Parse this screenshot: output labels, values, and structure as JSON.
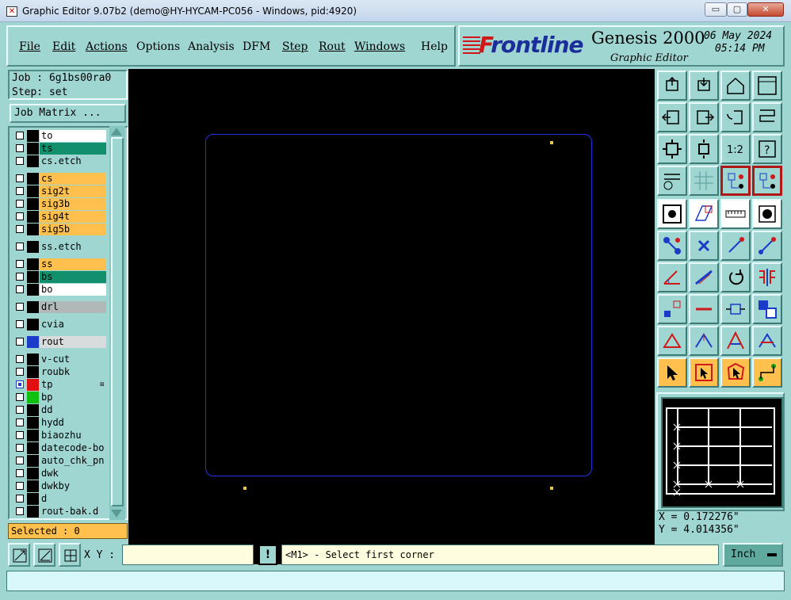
{
  "window": {
    "title": "Graphic Editor 9.07b2 (demo@HY-HYCAM-PC056 - Windows, pid:4920)",
    "min_glyph": "▭",
    "max_glyph": "▢",
    "close_glyph": "✕"
  },
  "menu": {
    "items": [
      "File",
      "Edit",
      "Actions",
      "Options",
      "Analysis",
      "DFM",
      "Step",
      "Rout",
      "Windows",
      "Help"
    ]
  },
  "brand": {
    "logo_text_f": "F",
    "logo_text_rest": "rontline",
    "product": "Genesis 2000",
    "subtitle": "Graphic Editor",
    "date": "06 May 2024",
    "time": "05:14 PM"
  },
  "job": {
    "job_line": "Job : 6g1bs00ra0",
    "step_line": "Step: set",
    "matrix_button": "Job Matrix ..."
  },
  "layers": [
    {
      "name": "to",
      "color": "#ffffff",
      "swatch": "#000000",
      "selected": false
    },
    {
      "name": "ts",
      "color": "#12906e",
      "swatch": "#000000",
      "selected": false
    },
    {
      "name": "cs.etch",
      "color": "#9fd6d2",
      "swatch": "#000000",
      "selected": false
    },
    {
      "name": "cs",
      "color": "#ffc04d",
      "swatch": "#000000",
      "selected": false
    },
    {
      "name": "sig2t",
      "color": "#ffc04d",
      "swatch": "#000000",
      "selected": false
    },
    {
      "name": "sig3b",
      "color": "#ffc04d",
      "swatch": "#000000",
      "selected": false
    },
    {
      "name": "sig4t",
      "color": "#ffc04d",
      "swatch": "#000000",
      "selected": false
    },
    {
      "name": "sig5b",
      "color": "#ffc04d",
      "swatch": "#000000",
      "selected": false
    },
    {
      "name": "ss.etch",
      "color": "#9fd6d2",
      "swatch": "#000000",
      "selected": false
    },
    {
      "name": "ss",
      "color": "#ffc04d",
      "swatch": "#000000",
      "selected": false
    },
    {
      "name": "bs",
      "color": "#12906e",
      "swatch": "#000000",
      "selected": false
    },
    {
      "name": "bo",
      "color": "#ffffff",
      "swatch": "#000000",
      "selected": false
    },
    {
      "name": "drl",
      "color": "#b0b8b8",
      "swatch": "#000000",
      "selected": false
    },
    {
      "name": "cvia",
      "color": "#9fd6d2",
      "swatch": "#000000",
      "selected": false
    },
    {
      "name": "rout",
      "color": "#d8dcdc",
      "swatch": "#1a3cc8",
      "selected": false
    },
    {
      "name": "v-cut",
      "color": "#9fd6d2",
      "swatch": "#000000",
      "selected": false
    },
    {
      "name": "roubk",
      "color": "#9fd6d2",
      "swatch": "#000000",
      "selected": false
    },
    {
      "name": "tp",
      "color": "#9fd6d2",
      "swatch": "#e01010",
      "selected": true,
      "tag": "⊞"
    },
    {
      "name": "bp",
      "color": "#9fd6d2",
      "swatch": "#10c010",
      "selected": false
    },
    {
      "name": "dd",
      "color": "#9fd6d2",
      "swatch": "#000000",
      "selected": false
    },
    {
      "name": "hydd",
      "color": "#9fd6d2",
      "swatch": "#000000",
      "selected": false
    },
    {
      "name": "biaozhu",
      "color": "#9fd6d2",
      "swatch": "#000000",
      "selected": false
    },
    {
      "name": "datecode-bo",
      "color": "#9fd6d2",
      "swatch": "#000000",
      "selected": false
    },
    {
      "name": "auto_chk_pn",
      "color": "#9fd6d2",
      "swatch": "#000000",
      "selected": false
    },
    {
      "name": "dwk",
      "color": "#9fd6d2",
      "swatch": "#000000",
      "selected": false
    },
    {
      "name": "dwkby",
      "color": "#9fd6d2",
      "swatch": "#000000",
      "selected": false
    },
    {
      "name": "d",
      "color": "#9fd6d2",
      "swatch": "#000000",
      "selected": false
    },
    {
      "name": "rout-bak.d",
      "color": "#9fd6d2",
      "swatch": "#000000",
      "selected": false
    }
  ],
  "selected_label": "Selected : 0",
  "coords": {
    "x_line": "X = 0.172276\"",
    "y_line": "Y = 4.014356\""
  },
  "status": {
    "xy_label": "X Y :",
    "xy_value": "",
    "excl_label": "!",
    "prompt": "<M1> - Select first corner",
    "units": "Inch"
  },
  "toolbox": {
    "tools": [
      "zoom-home-icon",
      "zoom-reset-icon",
      "home-icon",
      "window-icon",
      "pan-left-icon",
      "pan-right-icon",
      "undo-view-icon",
      "redraw-icon",
      "fit-all-icon",
      "fit-vertical-icon",
      "one-to-one-icon",
      "help-icon",
      "options-icon",
      "grid-icon",
      "layers-red-icon",
      "layers-red-icon-2",
      "snap-center-icon",
      "measure-shape-icon",
      "ruler-icon",
      "select-pad-icon",
      "connect-icon",
      "delete-node-icon",
      "line-point-icon",
      "line-point-2-icon",
      "angle-icon",
      "line-slope-icon",
      "rotate-icon",
      "mirror-icon",
      "align-icon",
      "minus-line-icon",
      "resize-icon",
      "group-icon",
      "arc-red-icon",
      "arc-blue-icon",
      "arc-tri-icon",
      "arc-measure-icon",
      "pointer-icon",
      "select-box-icon",
      "select-poly-icon",
      "route-icon"
    ]
  },
  "colors": {
    "panel": "#9fd6d2",
    "canvas": "#000000",
    "board_outline": "#2233dd",
    "pad": "#e6c84a",
    "selected_bg": "#ffc04d"
  }
}
